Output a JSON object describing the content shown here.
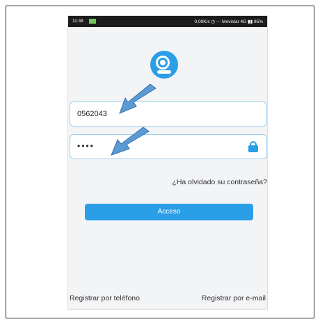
{
  "statusbar": {
    "time": "11:38",
    "right": "0,00K/s  ◷  ⋯  Movistar 4G  ▮▮  95%"
  },
  "form": {
    "username_value": "0562043",
    "password_value": "••••",
    "forgot_label": "¿Ha olvidado su contraseña?",
    "login_label": "Acceso"
  },
  "footer": {
    "register_phone": "Registrar por teléfono",
    "register_email": "Registrar por e-mail"
  },
  "icons": {
    "logo": "camera-icon",
    "lock": "lock-icon",
    "arrows": [
      "arrow-icon",
      "arrow-icon"
    ]
  },
  "colors": {
    "accent": "#2a9ee6",
    "arrow": "#5b9bd5"
  }
}
